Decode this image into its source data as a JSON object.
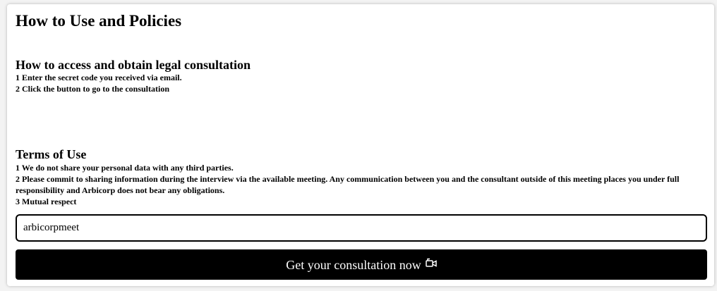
{
  "page": {
    "title": "How to Use and Policies"
  },
  "access_section": {
    "heading": "How to access and obtain legal consultation",
    "steps": [
      "1 Enter the secret code you received via email.",
      "2 Click the button to go to the consultation"
    ]
  },
  "terms_section": {
    "heading": "Terms of Use",
    "items": [
      "1 We do not share your personal data with any third parties.",
      "2 Please commit to sharing information during the interview via the available meeting. Any communication between you and the consultant outside of this meeting places you under full responsibility and Arbicorp does not bear any obligations.",
      "3 Mutual respect"
    ]
  },
  "code_input": {
    "value": "arbicorpmeet",
    "placeholder": ""
  },
  "consult_button": {
    "label": "Get your consultation now",
    "icon": "video-camera-icon"
  },
  "colors": {
    "button_bg": "#000000",
    "button_text": "#ffffff",
    "card_bg": "#ffffff"
  }
}
